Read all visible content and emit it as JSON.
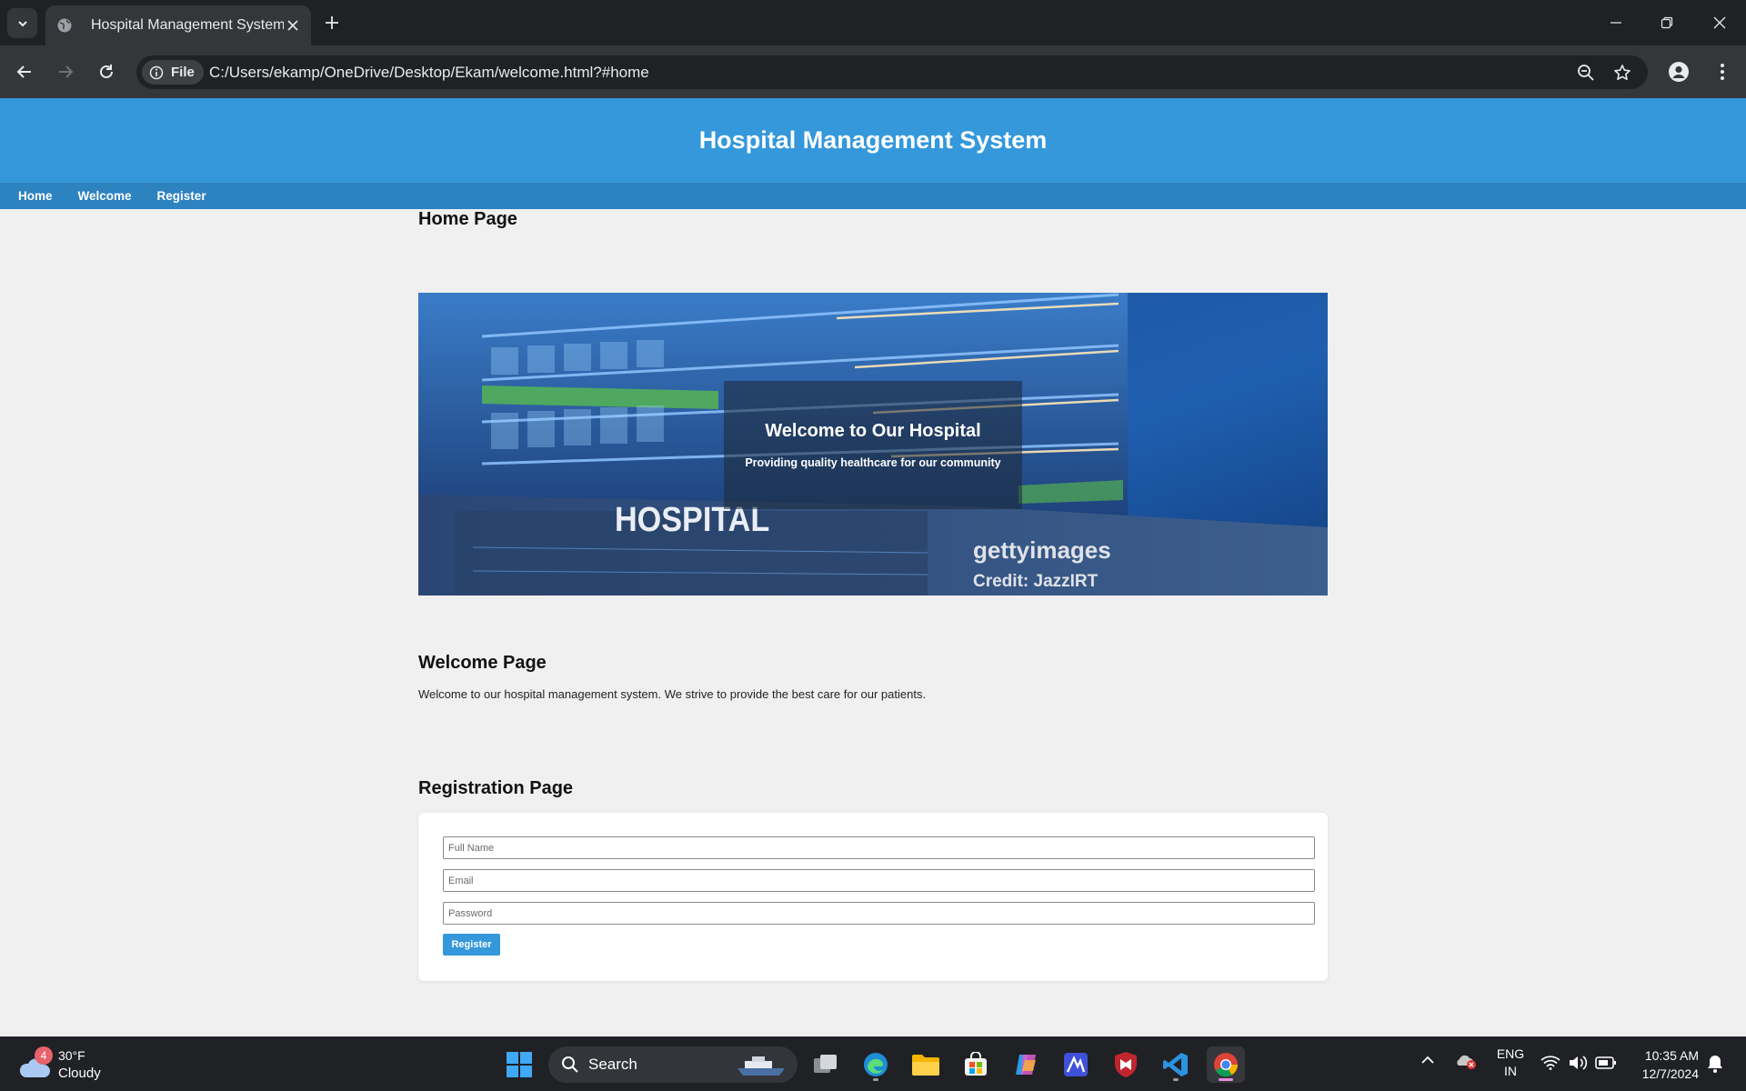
{
  "browser": {
    "tab_title": "Hospital Management System",
    "site_chip": "File",
    "url": "C:/Users/ekamp/OneDrive/Desktop/Ekam/welcome.html?#home"
  },
  "site": {
    "title": "Hospital Management System",
    "nav": [
      "Home",
      "Welcome",
      "Register"
    ]
  },
  "home": {
    "heading": "Home Page",
    "hero_title": "Welcome to Our Hospital",
    "hero_subtitle": "Providing quality healthcare for our community",
    "image_sign": "HOSPITAL",
    "watermark_brand": "gettyimages",
    "watermark_credit": "Credit: JazzIRT"
  },
  "welcome": {
    "heading": "Welcome Page",
    "text": "Welcome to our hospital management system. We strive to provide the best care for our patients."
  },
  "register": {
    "heading": "Registration Page",
    "full_name_placeholder": "Full Name",
    "email_placeholder": "Email",
    "password_placeholder": "Password",
    "button": "Register"
  },
  "taskbar": {
    "weather_badge": "4",
    "temperature": "30°F",
    "condition": "Cloudy",
    "search": "Search",
    "lang_top": "ENG",
    "lang_bottom": "IN",
    "time": "10:35 AM",
    "date": "12/7/2024"
  },
  "colors": {
    "header": "#3498db",
    "nav": "#2d82c0",
    "page_bg": "#f0f0f0",
    "button": "#3498db"
  }
}
